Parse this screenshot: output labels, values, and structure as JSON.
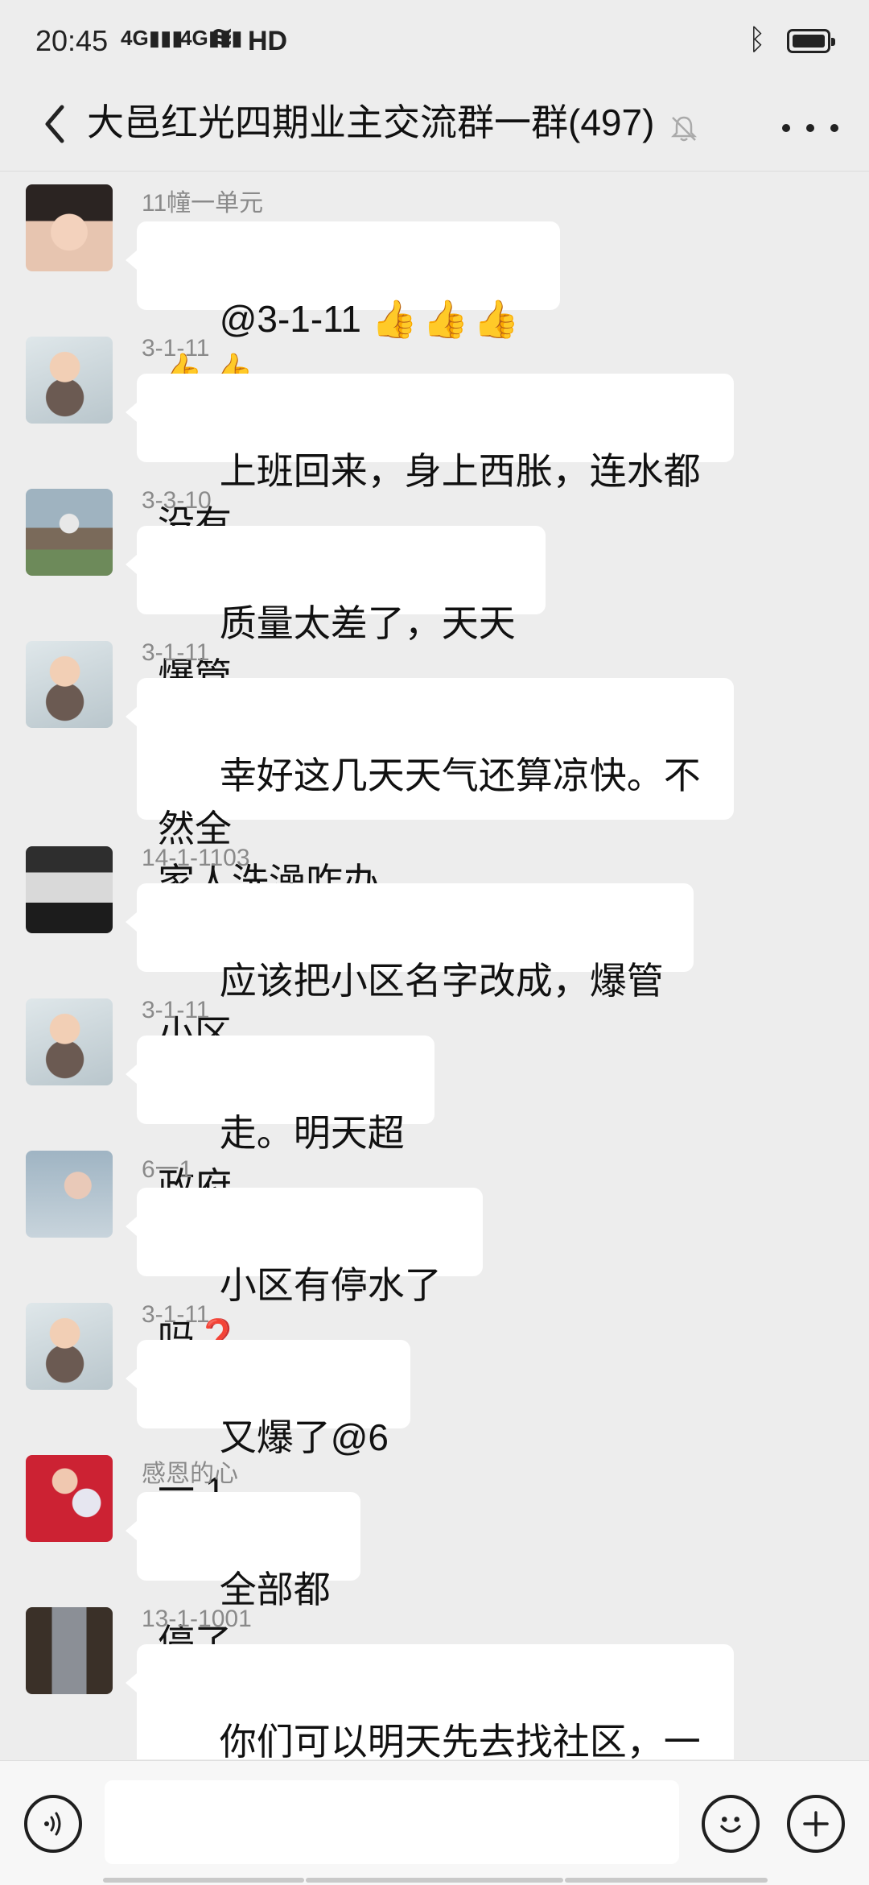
{
  "status": {
    "time": "20:45",
    "sig1": "4G",
    "sig2": "4G",
    "network": "HD"
  },
  "header": {
    "title": "大邑红光四期业主交流群一群(497)"
  },
  "messages": [
    {
      "sender": "11幢一单元",
      "text": "@3-1-11 ",
      "extra": "👍👍👍👍👍"
    },
    {
      "sender": "3-1-11",
      "text": "上班回来，身上西胀，连水都没有，"
    },
    {
      "sender": "3-3-10",
      "text": "质量太差了，天天爆管"
    },
    {
      "sender": "3-1-11",
      "text": "幸好这几天天气还算凉快。不然全\n家人洗澡咋办"
    },
    {
      "sender": "14-1-1103",
      "text": "应该把小区名字改成，爆管小区"
    },
    {
      "sender": "3-1-11",
      "text": "走。明天超政府"
    },
    {
      "sender": "6一1",
      "text": "小区有停水了吗",
      "extra": "❓"
    },
    {
      "sender": "3-1-11",
      "text": "又爆了@6 一 1"
    },
    {
      "sender": "感恩的心",
      "text": "全部都停了"
    },
    {
      "sender": "13-1-1001",
      "text": "你们可以明天先去找社区，一步一\n步来"
    }
  ]
}
